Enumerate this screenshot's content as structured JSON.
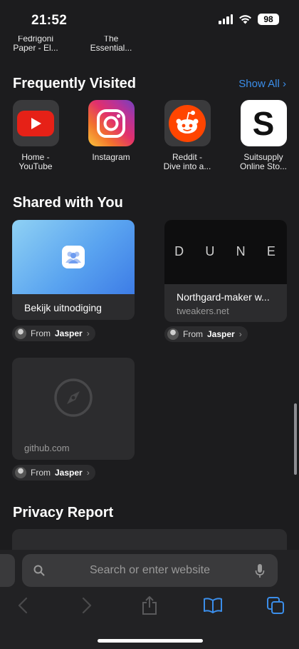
{
  "status": {
    "time": "21:52",
    "battery": "98"
  },
  "top_items": [
    {
      "line1": "Fedrigoni",
      "line2": "Paper - El..."
    },
    {
      "line1": "The",
      "line2": "Essential..."
    }
  ],
  "frequently_visited": {
    "title": "Frequently Visited",
    "show_all": "Show All",
    "items": [
      {
        "line1": "Home -",
        "line2": "YouTube",
        "icon": "youtube-icon"
      },
      {
        "line1": "Instagram",
        "line2": "",
        "icon": "instagram-icon"
      },
      {
        "line1": "Reddit -",
        "line2": "Dive into a...",
        "icon": "reddit-icon"
      },
      {
        "line1": "Suitsupply",
        "line2": "Online Sto...",
        "icon": "suitsupply-icon",
        "letter": "S"
      }
    ]
  },
  "shared_with_you": {
    "title": "Shared with You",
    "cards": [
      {
        "title": "Bekijk uitnodiging",
        "subtitle": "",
        "from_label": "From",
        "from_name": "Jasper"
      },
      {
        "title": "Northgard-maker w...",
        "subtitle": "tweakers.net",
        "banner_letters": [
          "D",
          "U",
          "N",
          "E"
        ],
        "from_label": "From",
        "from_name": "Jasper"
      },
      {
        "title": "github.com",
        "subtitle": "",
        "from_label": "From",
        "from_name": "Jasper"
      }
    ]
  },
  "privacy_report": {
    "title": "Privacy Report"
  },
  "search": {
    "placeholder": "Search or enter website"
  },
  "colors": {
    "accent": "#3b8eea",
    "background": "#1c1c1e",
    "card": "#2c2c2e"
  }
}
